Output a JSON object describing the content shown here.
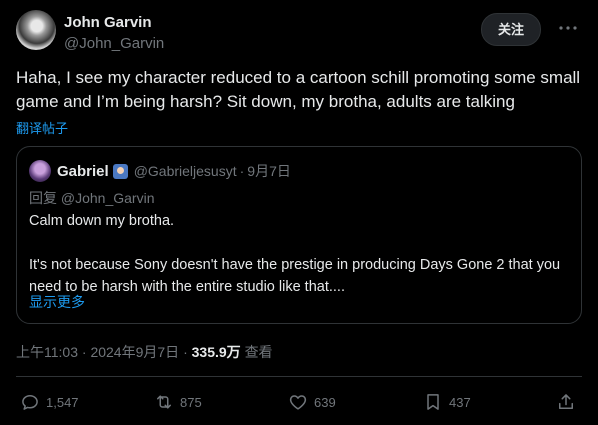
{
  "post": {
    "author": {
      "display_name": "John Garvin",
      "handle": "@John_Garvin"
    },
    "follow_label": "关注",
    "more_icon": "more-horizontal-icon",
    "text": "Haha, I see my character reduced to a cartoon schill promoting some small game and I’m being harsh? Sit down, my brotha, adults are talking",
    "translate_label": "翻译帖子",
    "quote": {
      "author": {
        "display_name": "Gabriel",
        "handle": "@Gabrieljesusyt"
      },
      "dot": "·",
      "date": "9月7日",
      "reply_to": "回复 @John_Garvin",
      "paragraphs": [
        "Calm down my brotha.",
        "It's not because Sony doesn't have the prestige in producing Days Gone 2 that you need to be harsh with the entire studio like that...."
      ],
      "show_more_label": "显示更多"
    },
    "meta": {
      "time": "上午11:03",
      "dot": "·",
      "date": "2024年9月7日",
      "dot2": "·",
      "views_count": "335.9万",
      "views_label": "查看"
    },
    "actions": {
      "replies": "1,547",
      "reposts": "875",
      "likes": "639",
      "bookmarks": "437"
    }
  },
  "colors": {
    "background": "#000000",
    "text": "#e7e9ea",
    "secondary": "#71767b",
    "link": "#1d9bf0",
    "border": "#2f3336"
  }
}
